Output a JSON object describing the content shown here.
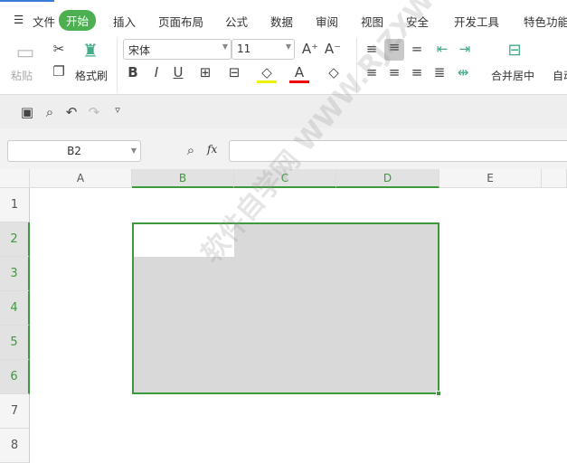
{
  "menu": {
    "hamburger": "☰",
    "items": [
      "文件",
      "开始",
      "插入",
      "页面布局",
      "公式",
      "数据",
      "审阅",
      "视图",
      "安全",
      "开发工具",
      "特色功能"
    ]
  },
  "ribbon": {
    "paste": "粘贴",
    "format_painter": "格式刷",
    "font_name": "宋体",
    "font_size": "11",
    "merge_center": "合并居中",
    "auto_wrap": "自动"
  },
  "formula_bar": {
    "cell_ref": "B2",
    "fx": "fx",
    "value": ""
  },
  "columns": [
    "A",
    "B",
    "C",
    "D",
    "E"
  ],
  "rows": [
    "1",
    "2",
    "3",
    "4",
    "5",
    "6",
    "7",
    "8"
  ],
  "selection": "B2:D6",
  "watermark": "软件自学网 WWW.RJZXW.COM",
  "colors": {
    "accent": "#4caf50",
    "selection_border": "#3c9a3c",
    "selection_fill": "#d9d9d9"
  }
}
